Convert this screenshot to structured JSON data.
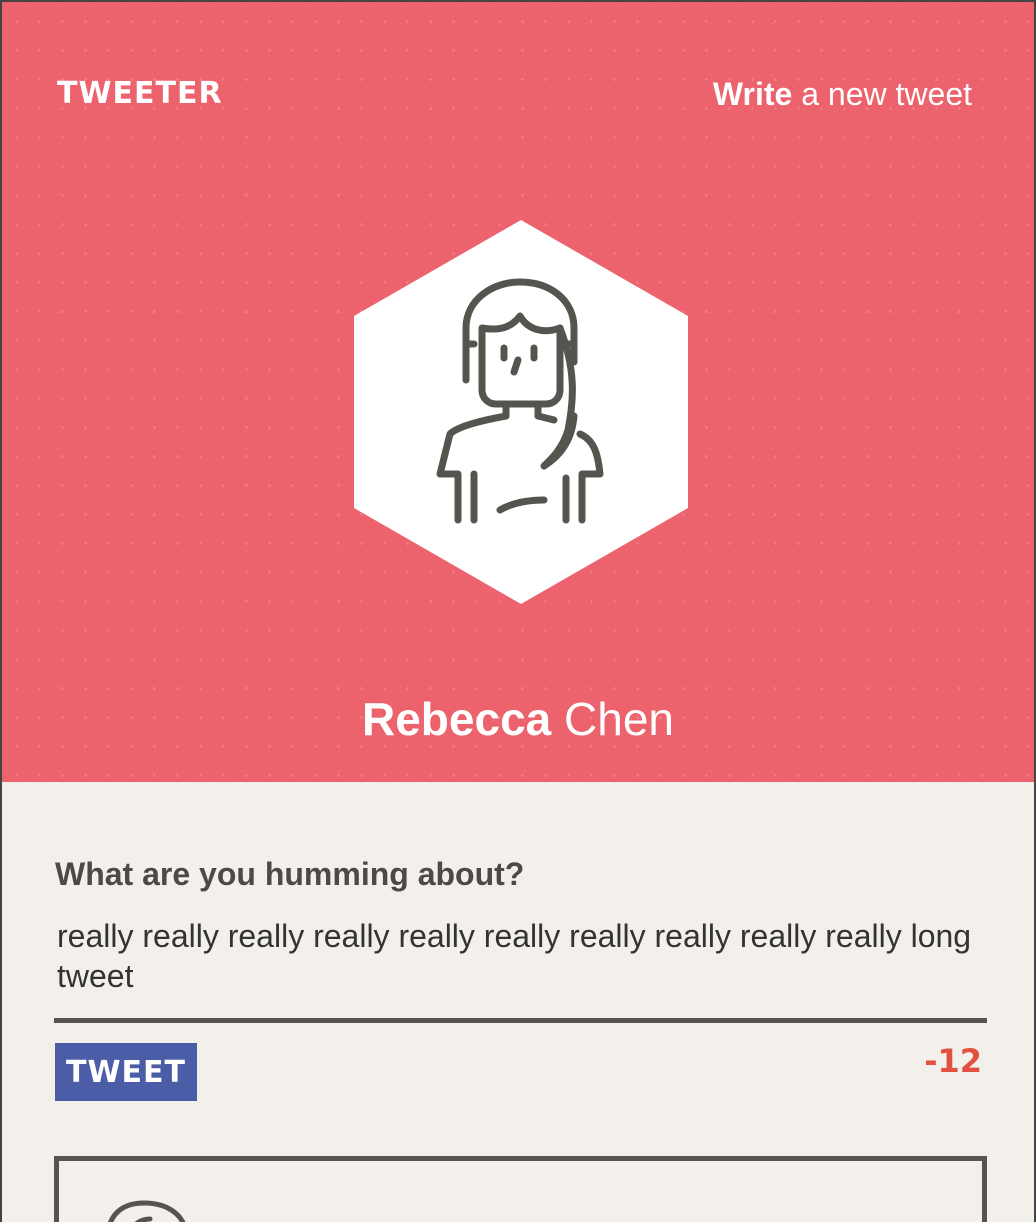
{
  "nav": {
    "brand": "TWEETER",
    "write_strong": "Write",
    "write_rest": " a new tweet"
  },
  "profile": {
    "first_name": "Rebecca",
    "last_name": "Chen",
    "avatar_icon": "woman-avatar-icon"
  },
  "composer": {
    "label": "What are you humming about?",
    "value": "really really really really really really really really really really long tweet",
    "button_label": "TWEET",
    "counter": "-12"
  },
  "colors": {
    "hero": "#ec626d",
    "button": "#4a5da6",
    "counter": "#e2503f",
    "text": "#4c4a45"
  }
}
